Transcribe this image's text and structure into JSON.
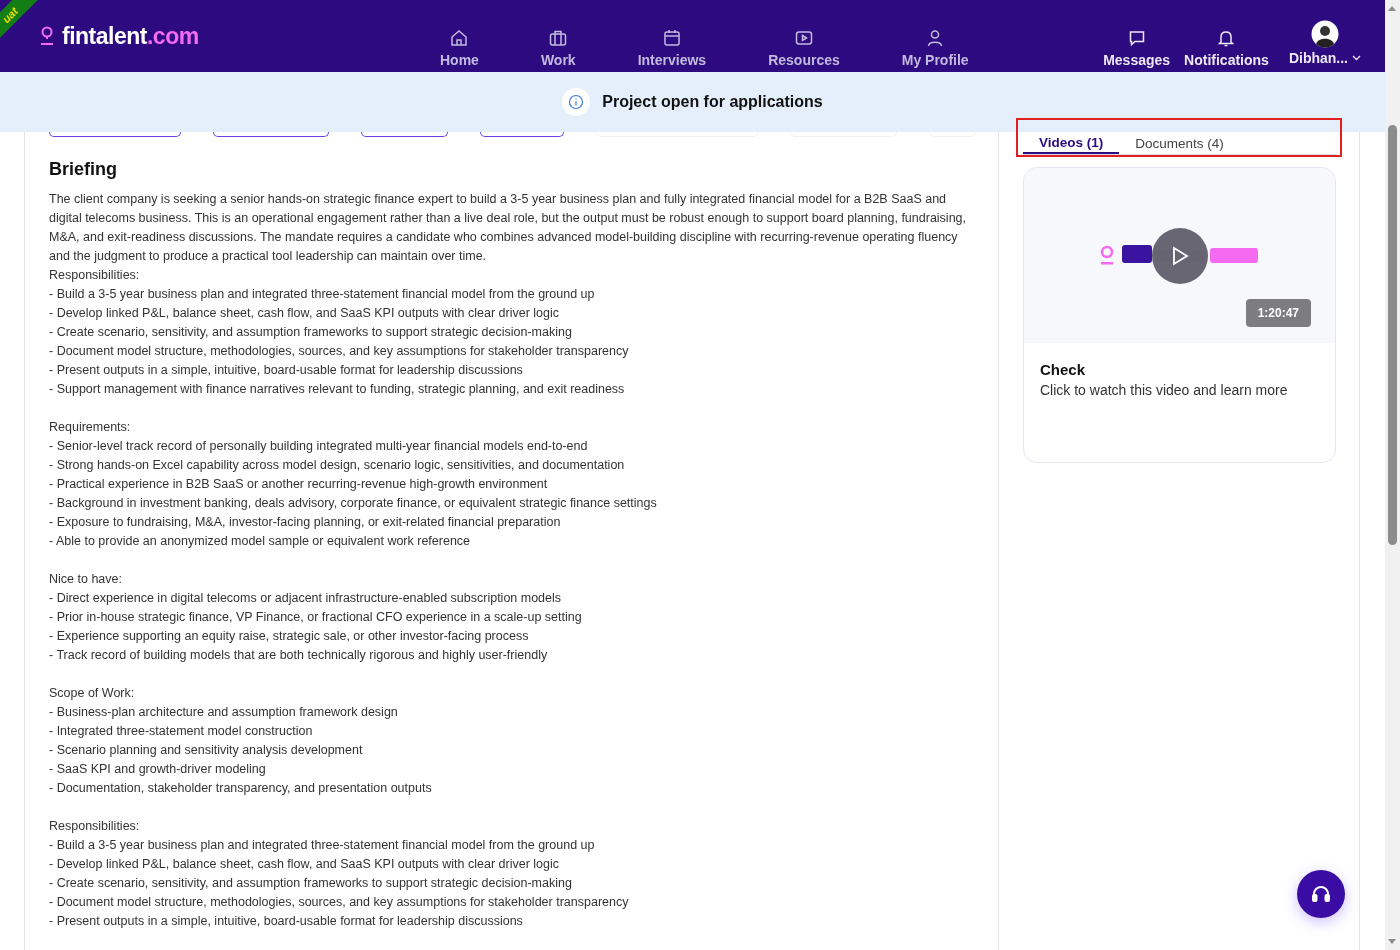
{
  "header": {
    "logo": {
      "name": "fintalent",
      "suffix": ".com"
    },
    "environment": "uat",
    "nav": [
      {
        "label": "Home"
      },
      {
        "label": "Work"
      },
      {
        "label": "Interviews"
      },
      {
        "label": "Resources"
      },
      {
        "label": "My Profile"
      }
    ],
    "actions": [
      {
        "label": "Messages"
      },
      {
        "label": "Notifications"
      }
    ],
    "user": {
      "name": "Dibhan..."
    }
  },
  "banner": {
    "text": "Project open for applications"
  },
  "filter_chips": [
    {
      "kind": "outlined"
    },
    {
      "kind": "outlined"
    },
    {
      "kind": "outlined"
    },
    {
      "kind": "outlined"
    },
    {
      "kind": "faded"
    },
    {
      "kind": "faded"
    },
    {
      "kind": "faded"
    }
  ],
  "briefing": {
    "title": "Briefing",
    "blocks": [
      {
        "kind": "paragraph",
        "text": "The client company is seeking a senior hands-on strategic finance expert to build a 3-5 year business plan and fully integrated financial model for a B2B SaaS and digital telecoms business. This is an operational engagement rather than a live deal role, but the output must be robust enough to support board planning, fundraising, M&A, and exit-readiness discussions. The mandate requires a candidate who combines advanced model-building discipline with recurring-revenue operating fluency and the judgment to produce a practical tool leadership can maintain over time."
      },
      {
        "kind": "list",
        "heading": "Responsibilities:",
        "items": [
          "- Build a 3-5 year business plan and integrated three-statement financial model from the ground up",
          "- Develop linked P&L, balance sheet, cash flow, and SaaS KPI outputs with clear driver logic",
          "- Create scenario, sensitivity, and assumption frameworks to support strategic decision-making",
          "- Document model structure, methodologies, sources, and key assumptions for stakeholder transparency",
          "- Present outputs in a simple, intuitive, board-usable format for leadership discussions",
          "- Support management with finance narratives relevant to funding, strategic planning, and exit readiness"
        ]
      },
      {
        "kind": "list",
        "heading": "Requirements:",
        "items": [
          "- Senior-level track record of personally building integrated multi-year financial models end-to-end",
          "- Strong hands-on Excel capability across model design, scenario logic, sensitivities, and documentation",
          "- Practical experience in B2B SaaS or another recurring-revenue high-growth environment",
          "- Background in investment banking, deals advisory, corporate finance, or equivalent strategic finance settings",
          "- Exposure to fundraising, M&A, investor-facing planning, or exit-related financial preparation",
          "- Able to provide an anonymized model sample or equivalent work reference"
        ]
      },
      {
        "kind": "list",
        "heading": "Nice to have:",
        "items": [
          "- Direct experience in digital telecoms or adjacent infrastructure-enabled subscription models",
          "- Prior in-house strategic finance, VP Finance, or fractional CFO experience in a scale-up setting",
          "- Experience supporting an equity raise, strategic sale, or other investor-facing process",
          "- Track record of building models that are both technically rigorous and highly user-friendly"
        ]
      },
      {
        "kind": "list",
        "heading": "Scope of Work:",
        "items": [
          "- Business-plan architecture and assumption framework design",
          "- Integrated three-statement model construction",
          "- Scenario planning and sensitivity analysis development",
          "- SaaS KPI and growth-driver modeling",
          "- Documentation, stakeholder transparency, and presentation outputs"
        ]
      },
      {
        "kind": "list",
        "heading": "Responsibilities:",
        "items": [
          "- Build a 3-5 year business plan and integrated three-statement financial model from the ground up",
          "- Develop linked P&L, balance sheet, cash flow, and SaaS KPI outputs with clear driver logic",
          "- Create scenario, sensitivity, and assumption frameworks to support strategic decision-making",
          "- Document model structure, methodologies, sources, and key assumptions for stakeholder transparency",
          "- Present outputs in a simple, intuitive, board-usable format for leadership discussions"
        ]
      }
    ]
  },
  "media_tabs": [
    {
      "label": "Videos (1)",
      "selected": true
    },
    {
      "label": "Documents (4)",
      "selected": false
    }
  ],
  "video": {
    "duration": "1:20:47",
    "title": "Check",
    "description": "Click to watch this video and learn more"
  }
}
